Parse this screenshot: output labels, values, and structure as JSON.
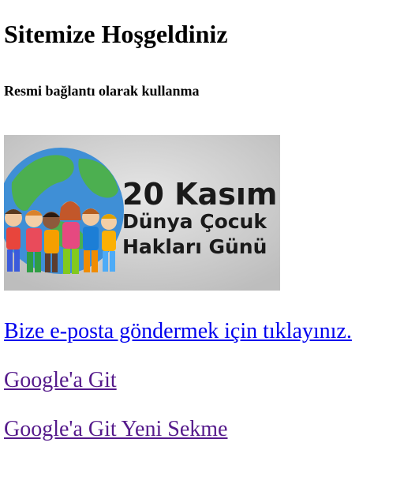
{
  "page": {
    "title": "Sitemize Hoşgeldiniz",
    "subtitle": "Resmi bağlantı olarak kullanma"
  },
  "banner": {
    "line1": "20 Kasım",
    "line2": "Dünya Çocuk",
    "line3": "Hakları Günü",
    "icon": "children-around-globe-image"
  },
  "links": {
    "email": "Bize e-posta göndermek için tıklayınız.",
    "google": "Google'a Git",
    "google_new_tab": "Google'a Git Yeni Sekme"
  },
  "colors": {
    "link_unvisited": "#0000ee",
    "link_visited": "#551a8b",
    "banner_background": "#cfcfcf",
    "banner_text": "#1a1a1a"
  }
}
